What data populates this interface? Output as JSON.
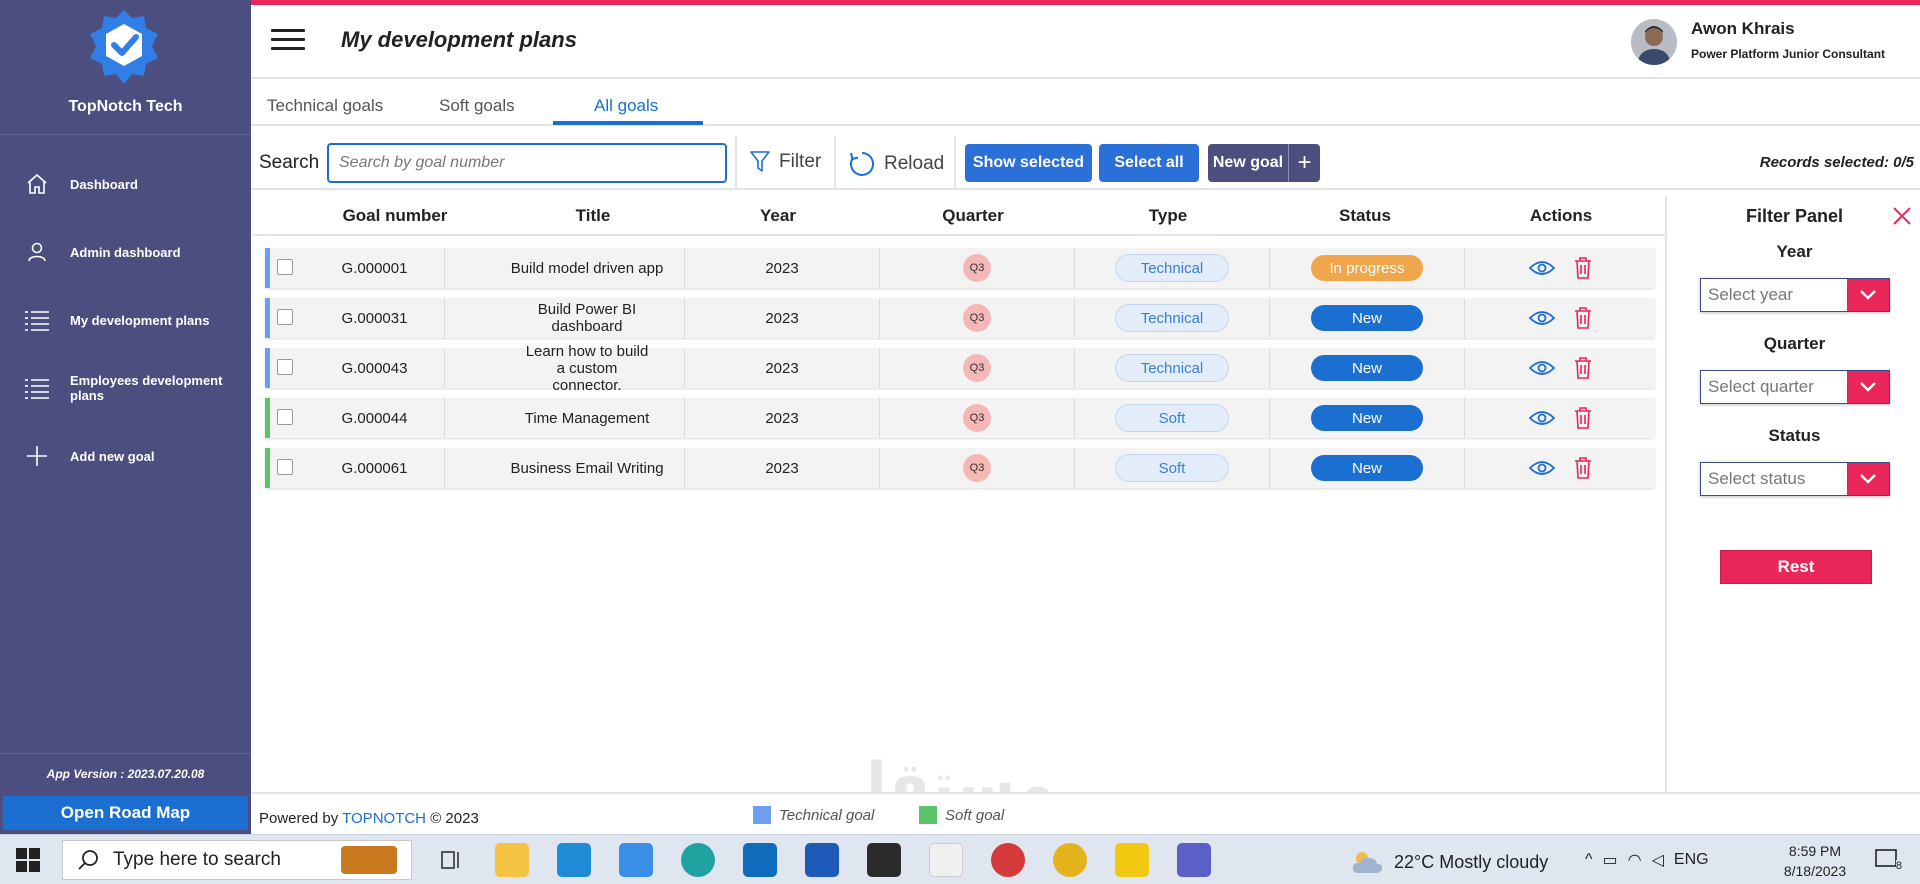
{
  "brand": {
    "name": "TopNotch Tech"
  },
  "sidebar": {
    "items": [
      {
        "label": "Dashboard",
        "icon": "home-icon"
      },
      {
        "label": "Admin dashboard",
        "icon": "user-icon"
      },
      {
        "label": "My development plans",
        "icon": "list-icon"
      },
      {
        "label": "Employees development plans",
        "icon": "list-icon"
      },
      {
        "label": "Add new goal",
        "icon": "plus-icon"
      }
    ],
    "version": "App Version : 2023.07.20.08",
    "roadmap_button": "Open Road Map"
  },
  "header": {
    "title": "My development plans",
    "user_name": "Awon Khrais",
    "user_role": "Power Platform Junior Consultant"
  },
  "tabs": [
    {
      "label": "Technical goals"
    },
    {
      "label": "Soft goals"
    },
    {
      "label": "All goals",
      "active": true
    }
  ],
  "toolbar": {
    "search_label": "Search",
    "search_placeholder": "Search by goal number",
    "filter_label": "Filter",
    "reload_label": "Reload",
    "show_selected_label": "Show selected",
    "select_all_label": "Select all",
    "new_goal_label": "New goal",
    "records_selected": "Records selected: 0/5"
  },
  "table": {
    "columns": [
      "Goal number",
      "Title",
      "Year",
      "Quarter",
      "Type",
      "Status",
      "Actions"
    ],
    "rows": [
      {
        "goal_number": "G.000001",
        "title": "Build model driven app",
        "year": "2023",
        "quarter": "Q3",
        "type": "Technical",
        "status": "In progress"
      },
      {
        "goal_number": "G.000031",
        "title": "Build Power BI dashboard",
        "year": "2023",
        "quarter": "Q3",
        "type": "Technical",
        "status": "New"
      },
      {
        "goal_number": "G.000043",
        "title": "Learn how to build a custom connector.",
        "year": "2023",
        "quarter": "Q3",
        "type": "Technical",
        "status": "New"
      },
      {
        "goal_number": "G.000044",
        "title": "Time Management",
        "year": "2023",
        "quarter": "Q3",
        "type": "Soft",
        "status": "New"
      },
      {
        "goal_number": "G.000061",
        "title": "Business Email Writing",
        "year": "2023",
        "quarter": "Q3",
        "type": "Soft",
        "status": "New"
      }
    ]
  },
  "filter_panel": {
    "title": "Filter Panel",
    "year_label": "Year",
    "year_placeholder": "Select year",
    "quarter_label": "Quarter",
    "quarter_placeholder": "Select quarter",
    "status_label": "Status",
    "status_placeholder": "Select status",
    "reset_label": "Rest"
  },
  "footer": {
    "powered_by": "Powered by",
    "powered_brand": "TOPNOTCH",
    "copyright": "© 2023",
    "legend": [
      {
        "label": "Technical goal",
        "color": "#6e9ef0"
      },
      {
        "label": "Soft goal",
        "color": "#5cc46a"
      }
    ],
    "watermark": "مستقل"
  },
  "taskbar": {
    "search_placeholder": "Type here to search",
    "weather": "22°C  Mostly cloudy",
    "language": "ENG",
    "time": "8:59 PM",
    "date": "8/18/2023",
    "notification_count": "8"
  },
  "colors": {
    "sidebar_bg": "#4b4e7f",
    "accent": "#e8265a",
    "primary_blue": "#1b6fd1",
    "technical_bar": "#6e9ef0",
    "soft_bar": "#5cc46a",
    "status_new": "#1b6fd1",
    "status_in_progress": "#f0a64a"
  }
}
